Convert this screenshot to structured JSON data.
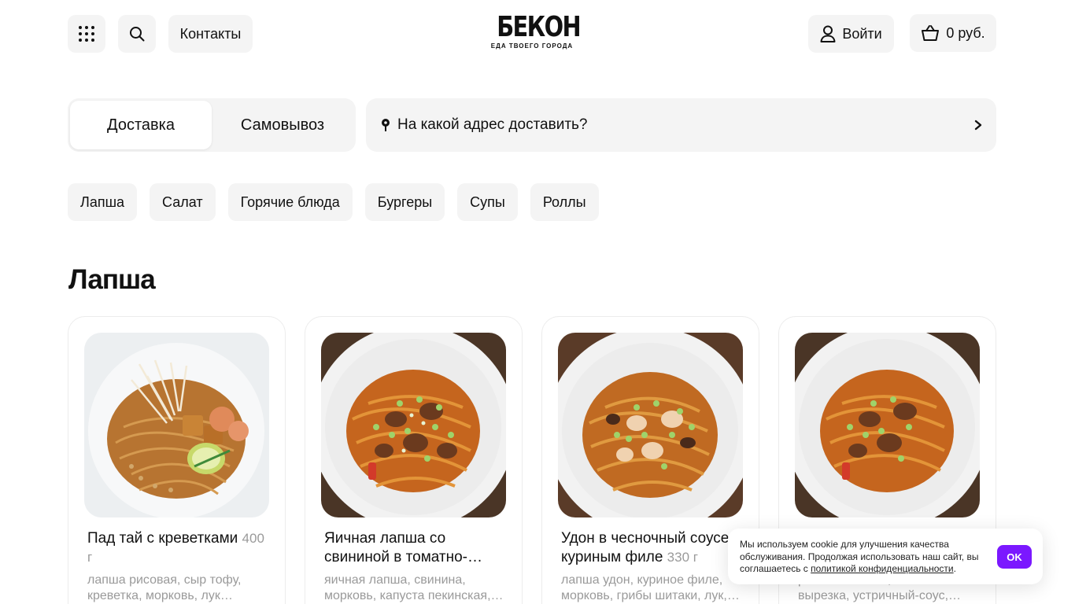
{
  "header": {
    "contacts_label": "Контакты",
    "logo_main": "БЕКОН",
    "logo_tagline": "ЕДА ТВОЕГО ГОРОДА",
    "login_label": "Войти",
    "cart_total": "0 руб."
  },
  "delivery_mode": {
    "delivery_label": "Доставка",
    "pickup_label": "Самовывоз",
    "selected": "Доставка",
    "address_prompt": "На какой адрес доставить?"
  },
  "categories": [
    "Лапша",
    "Салат",
    "Горячие блюда",
    "Бургеры",
    "Супы",
    "Роллы"
  ],
  "section": {
    "title": "Лапша"
  },
  "products": [
    {
      "name": "Пад тай с креветками",
      "weight": "400 г",
      "description": "лапша рисовая, сыр тофу, креветка, морковь, лук…",
      "image": "pad-thai-shrimp"
    },
    {
      "name": "Яичная лапша со свининой в томатно-…",
      "weight": "",
      "description": "яичная лапша, свинина, морковь, капуста пекинская,…",
      "image": "egg-noodles-pork"
    },
    {
      "name": "Удон в чесночный соусе с куриным филе",
      "weight": "330 г",
      "description": "лапша удон, куриное филе, морковь, грибы шитаки, лук,…",
      "image": "udon-chicken"
    },
    {
      "name": "",
      "weight": "",
      "description": "рисовая лапша, говяжья вырезка, устричный-соус,…",
      "image": "rice-noodles-beef"
    }
  ],
  "cookie_banner": {
    "text": "Мы используем cookie для улучшения качества обслуживания. Продолжая использовать наш сайт, вы соглашаетесь с ",
    "link_text": "политикой конфиденциальности",
    "ok_label": "OK",
    "accent_color": "#7b18ff"
  },
  "colors": {
    "chip_bg": "#f4f4f4",
    "muted_text": "#9a9a9a",
    "accent": "#7b18ff"
  }
}
